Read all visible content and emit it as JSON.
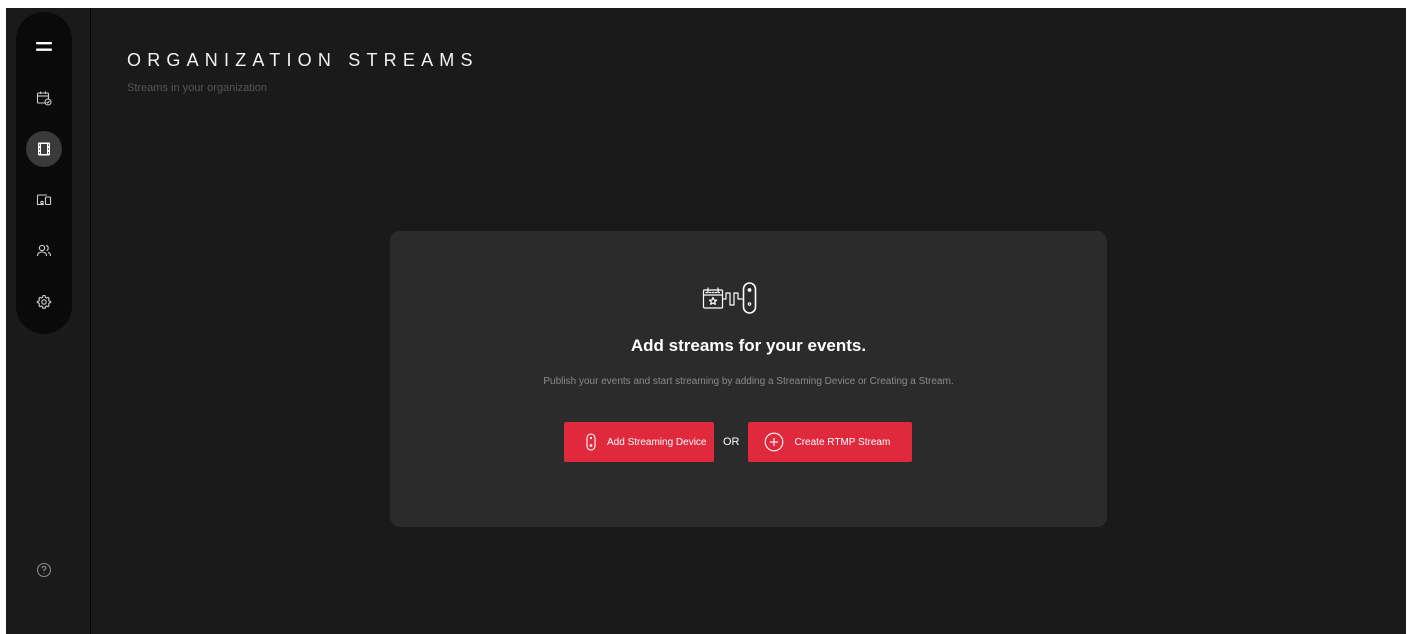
{
  "sidebar": {
    "items": [
      {
        "name": "menu",
        "icon": "menu-icon",
        "active": false
      },
      {
        "name": "events",
        "icon": "calendar-check-icon",
        "active": false
      },
      {
        "name": "streams",
        "icon": "film-icon",
        "active": true
      },
      {
        "name": "devices",
        "icon": "devices-icon",
        "active": false
      },
      {
        "name": "users",
        "icon": "users-icon",
        "active": false
      },
      {
        "name": "settings",
        "icon": "gear-icon",
        "active": false
      }
    ],
    "help_icon": "help-circle-icon"
  },
  "header": {
    "title": "ORGANIZATION STREAMS",
    "subtitle": "Streams in your organization"
  },
  "empty_state": {
    "illustration_icon": "calendar-wave-remote-icon",
    "heading": "Add streams for your events.",
    "description": "Publish your events and start streaming by adding a Streaming Device or Creating a Stream.",
    "add_device_label": "Add Streaming Device",
    "add_device_icon": "remote-icon",
    "separator": "OR",
    "create_rtmp_label": "Create RTMP Stream",
    "create_rtmp_icon": "plus-circle-icon"
  },
  "colors": {
    "background": "#1a1a1a",
    "sidebar": "#0a0a0a",
    "card": "#2b2b2b",
    "accent": "#e0293d",
    "title": "#f2f2f2",
    "muted": "#8a8a8a"
  }
}
